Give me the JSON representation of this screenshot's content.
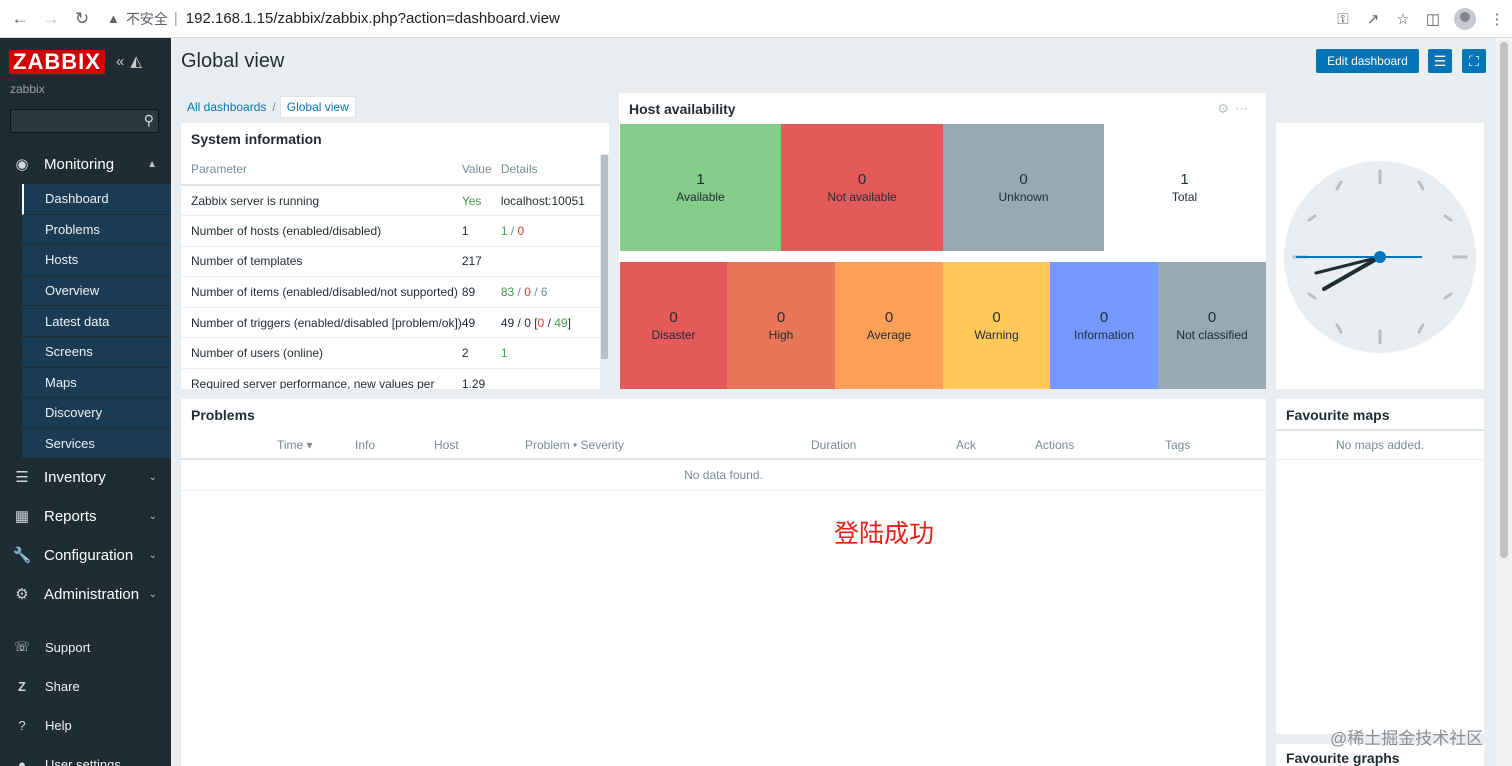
{
  "browser": {
    "insecure": "不安全",
    "separator": "|",
    "url": "192.168.1.15/zabbix/zabbix.php?action=dashboard.view"
  },
  "sidebar": {
    "logo": "ZABBIX",
    "user": "zabbix",
    "monitoring": {
      "label": "Monitoring",
      "items": [
        "Dashboard",
        "Problems",
        "Hosts",
        "Overview",
        "Latest data",
        "Screens",
        "Maps",
        "Discovery",
        "Services"
      ]
    },
    "sections": [
      "Inventory",
      "Reports",
      "Configuration",
      "Administration"
    ],
    "footer": [
      "Support",
      "Share",
      "Help",
      "User settings"
    ]
  },
  "header": {
    "title": "Global view",
    "edit_button": "Edit dashboard"
  },
  "breadcrumb": {
    "all": "All dashboards",
    "sep": "/",
    "current": "Global view"
  },
  "system_info": {
    "title": "System information",
    "columns": [
      "Parameter",
      "Value",
      "Details"
    ],
    "rows": [
      {
        "param": "Zabbix server is running",
        "value": "Yes",
        "details": "localhost:10051"
      },
      {
        "param": "Number of hosts (enabled/disabled)",
        "value": "1",
        "d1": "1",
        "d2": "0"
      },
      {
        "param": "Number of templates",
        "value": "217"
      },
      {
        "param": "Number of items (enabled/disabled/not supported)",
        "value": "89",
        "d1": "83",
        "d2": "0",
        "d3": "6"
      },
      {
        "param": "Number of triggers (enabled/disabled [problem/ok])",
        "value": "49",
        "d1": "49",
        "d2": "0",
        "d3": "0",
        "d4": "49"
      },
      {
        "param": "Number of users (online)",
        "value": "2",
        "d1": "1"
      },
      {
        "param": "Required server performance, new values per",
        "value": "1.29"
      }
    ]
  },
  "host_availability": {
    "title": "Host availability",
    "status": [
      {
        "count": "1",
        "label": "Available",
        "color": "#86cc89"
      },
      {
        "count": "0",
        "label": "Not available",
        "color": "#e45959"
      },
      {
        "count": "0",
        "label": "Unknown",
        "color": "#97aab3"
      },
      {
        "count": "1",
        "label": "Total",
        "color": "#ffffff"
      }
    ],
    "severity": [
      {
        "count": "0",
        "label": "Disaster",
        "color": "#e45959"
      },
      {
        "count": "0",
        "label": "High",
        "color": "#e97659"
      },
      {
        "count": "0",
        "label": "Average",
        "color": "#ffa059"
      },
      {
        "count": "0",
        "label": "Warning",
        "color": "#ffc859"
      },
      {
        "count": "0",
        "label": "Information",
        "color": "#7499ff"
      },
      {
        "count": "0",
        "label": "Not classified",
        "color": "#97aab3"
      }
    ]
  },
  "problems": {
    "title": "Problems",
    "columns": [
      "Time ▾",
      "Info",
      "Host",
      "Problem • Severity",
      "Duration",
      "Ack",
      "Actions",
      "Tags"
    ],
    "empty": "No data found."
  },
  "annotation": "登陆成功",
  "favourite_maps": {
    "title": "Favourite maps",
    "empty": "No maps added."
  },
  "favourite_graphs": {
    "title": "Favourite graphs"
  },
  "watermark": "@稀土掘金技术社区",
  "colors": {
    "sidebar_bg": "#1f2c33",
    "accent": "#0275b8",
    "logo_red": "#d40000"
  }
}
